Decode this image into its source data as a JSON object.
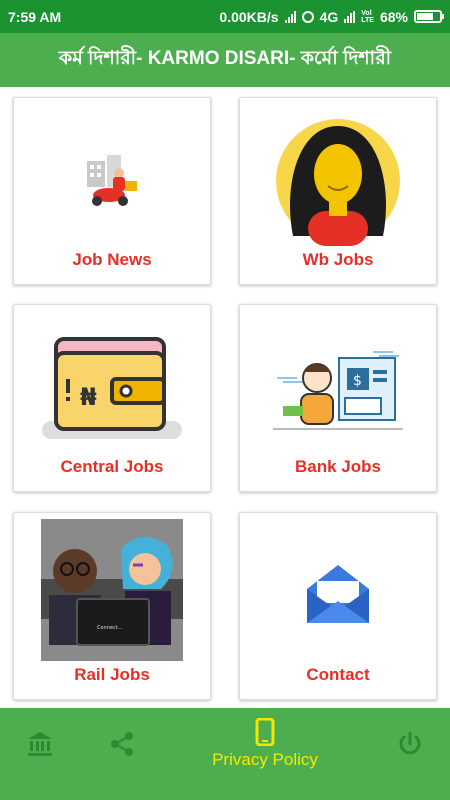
{
  "status_bar": {
    "time": "7:59 AM",
    "network_speed": "0.00KB/s",
    "network_type": "4G",
    "volte_top": "Vol",
    "volte_bottom": "LTE",
    "battery": "68%"
  },
  "app_bar": {
    "title": "কর্ম দিশারী- KARMO DISARI- কর্মো দিশারী"
  },
  "cards": [
    {
      "label": "Job News",
      "icon": "delivery-scooter-illustration"
    },
    {
      "label": "Wb Jobs",
      "icon": "woman-avatar-illustration"
    },
    {
      "label": "Central Jobs",
      "icon": "wallet-illustration"
    },
    {
      "label": "Bank Jobs",
      "icon": "atm-man-illustration"
    },
    {
      "label": "Rail Jobs",
      "icon": "people-laptop-photo"
    },
    {
      "label": "Contact",
      "icon": "envelope-icon"
    }
  ],
  "laptop_screen_text": "Connect...",
  "bottom_nav": {
    "items": [
      {
        "icon": "bank-icon",
        "label": ""
      },
      {
        "icon": "share-icon",
        "label": ""
      },
      {
        "icon": "phone-icon",
        "label": "Privacy Policy"
      },
      {
        "icon": "power-icon",
        "label": ""
      }
    ]
  },
  "colors": {
    "status_bar": "#1b9331",
    "app_bar": "#4cae4f",
    "label_red": "#e53026",
    "nav_yellow": "#f6e700"
  }
}
